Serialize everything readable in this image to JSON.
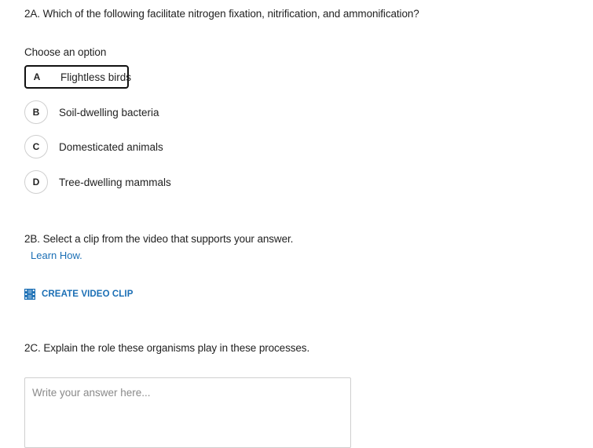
{
  "q2a": {
    "question": "2A. Which of the following facilitate nitrogen fixation, nitrification, and ammonification?",
    "prompt": "Choose an option",
    "options": [
      {
        "letter": "A",
        "label": "Flightless birds",
        "selected": true
      },
      {
        "letter": "B",
        "label": "Soil-dwelling bacteria",
        "selected": false
      },
      {
        "letter": "C",
        "label": "Domesticated animals",
        "selected": false
      },
      {
        "letter": "D",
        "label": "Tree-dwelling mammals",
        "selected": false
      }
    ]
  },
  "q2b": {
    "question": "2B. Select a clip from the video that supports your answer.",
    "learn_how": "Learn How.",
    "clip_button": "CREATE VIDEO CLIP",
    "clip_icon": "film-icon"
  },
  "q2c": {
    "question": "2C. Explain the role these organisms play in these processes.",
    "answer_value": "",
    "answer_placeholder": "Write your answer here..."
  },
  "colors": {
    "link": "#1b6fb5",
    "selected_border": "#111111",
    "option_border": "#cfcfcf"
  }
}
